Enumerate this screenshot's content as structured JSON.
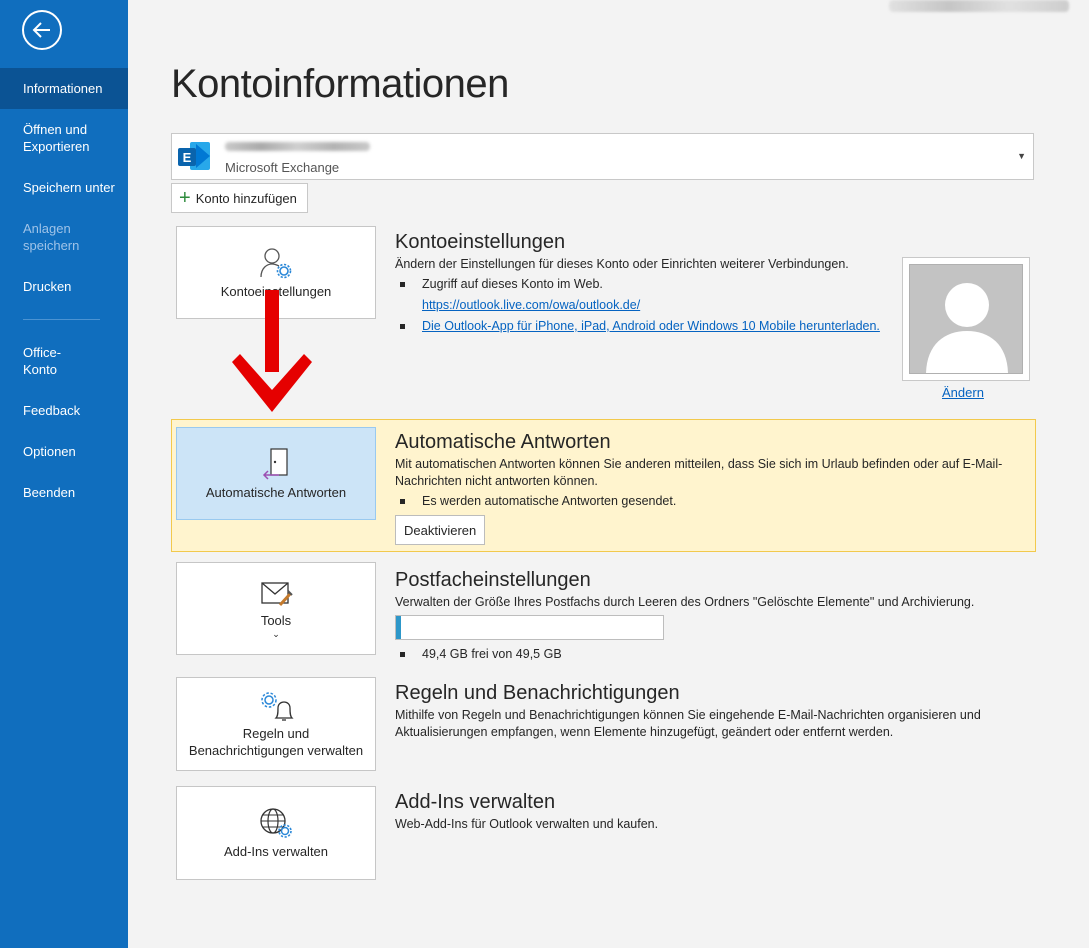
{
  "sidebar": {
    "items": [
      {
        "label": "Informationen",
        "active": true
      },
      {
        "label": "Öffnen und Exportieren"
      },
      {
        "label": "Speichern unter"
      },
      {
        "label": "Anlagen speichern",
        "disabled": true
      },
      {
        "label": "Drucken"
      },
      {
        "label": "Office-Konto"
      },
      {
        "label": "Feedback"
      },
      {
        "label": "Optionen"
      },
      {
        "label": "Beenden"
      }
    ]
  },
  "page": {
    "title": "Kontoinformationen"
  },
  "account": {
    "type": "Microsoft Exchange",
    "add_label": "Konto hinzufügen"
  },
  "sections": {
    "account_settings": {
      "tile_label": "Kontoeinstellungen",
      "title": "Kontoeinstellungen",
      "description": "Ändern der Einstellungen für dieses Konto oder Einrichten weiterer Verbindungen.",
      "bullet1": "Zugriff auf dieses Konto im Web.",
      "link1": "https://outlook.live.com/owa/outlook.de/",
      "link2": "Die Outlook-App für iPhone, iPad, Android oder Windows 10 Mobile herunterladen.",
      "change_label": "Ändern"
    },
    "auto_reply": {
      "tile_label": "Automatische Antworten",
      "title": "Automatische Antworten",
      "description": "Mit automatischen Antworten können Sie anderen mitteilen, dass Sie sich im Urlaub befinden oder auf E-Mail-Nachrichten nicht antworten können.",
      "bullet": "Es werden automatische Antworten gesendet.",
      "button_label": "Deaktivieren"
    },
    "mailbox": {
      "tile_label": "Tools",
      "title": "Postfacheinstellungen",
      "description": "Verwalten der Größe Ihres Postfachs durch Leeren des Ordners \"Gelöschte Elemente\" und Archivierung.",
      "storage_text": "49,4 GB frei von 49,5 GB",
      "storage_used_fraction": 0.02
    },
    "rules": {
      "tile_label": "Regeln und Benachrichtigungen verwalten",
      "title": "Regeln und Benachrichtigungen",
      "description": "Mithilfe von Regeln und Benachrichtigungen können Sie eingehende E-Mail-Nachrichten organisieren und Aktualisierungen empfangen, wenn Elemente hinzugefügt, geändert oder entfernt werden."
    },
    "addins": {
      "tile_label": "Add-Ins verwalten",
      "title": "Add-Ins verwalten",
      "description": "Web-Add-Ins für Outlook verwalten und kaufen."
    }
  },
  "colors": {
    "sidebar": "#106ebe",
    "accent_link": "#0563c1",
    "highlight_bg": "#fff4ce",
    "arrow": "#e50000"
  }
}
